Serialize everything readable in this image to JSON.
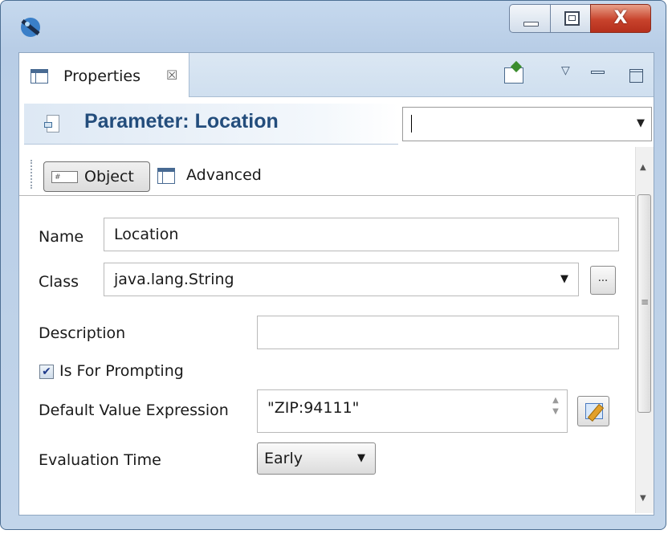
{
  "window": {
    "app_icon": "eclipse-app-icon",
    "controls": {
      "minimize_icon": "minimize-icon",
      "maximize_icon": "maximize-icon",
      "close_label": "X"
    }
  },
  "view": {
    "tab_label": "Properties",
    "tab_close_glyph": "☒",
    "toolbar": {
      "pin_icon": "pin-view-icon",
      "menu_glyph": "▽",
      "minimize_icon": "minimize-view-icon",
      "maximize_icon": "maximize-view-icon"
    }
  },
  "header": {
    "title": "Parameter: Location",
    "combo_value": ""
  },
  "segments": {
    "object_label": "Object",
    "object_icon_text": "#",
    "advanced_label": "Advanced"
  },
  "form": {
    "name_label": "Name",
    "name_value": "Location",
    "class_label": "Class",
    "class_value": "java.lang.String",
    "ellipsis_label": "...",
    "description_label": "Description",
    "description_value": "",
    "prompting_label": "Is For Prompting",
    "prompting_checked": true,
    "default_expr_label": "Default Value Expression",
    "default_expr_value": "\"ZIP:94111\"",
    "eval_time_label": "Evaluation Time",
    "eval_time_value": "Early"
  },
  "colors": {
    "title_blue": "#234d7c",
    "close_red": "#c8432c",
    "frame": "#c2d5ea"
  }
}
